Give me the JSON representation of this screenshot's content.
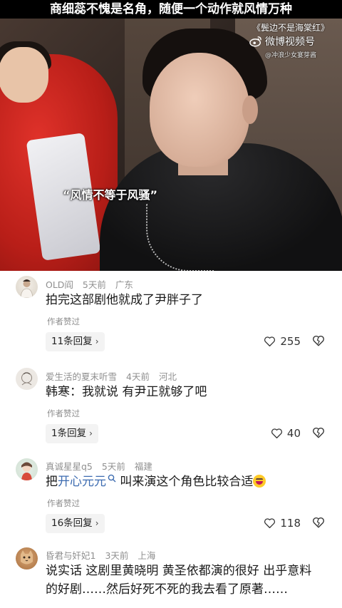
{
  "video": {
    "headline": "商细蕊不愧是名角，随便一个动作就风情万种",
    "watermark_tag": "《鬓边不是海棠红》",
    "watermark_brand": "微博视频号",
    "watermark_user": "@冲浪少女宴芽酱",
    "subtitle": "“风情不等于风骚”"
  },
  "comments": [
    {
      "username": "OLD阎",
      "time": "5天前",
      "location": "广东",
      "text": "拍完这部剧他就成了尹胖子了",
      "badge": "作者赞过",
      "reply_label": "11条回复",
      "likes": "255"
    },
    {
      "username": "爱生活的夏末听雪",
      "time": "4天前",
      "location": "河北",
      "text": "韩寒：我就说 有尹正就够了吧",
      "badge": "作者赞过",
      "reply_label": "1条回复",
      "likes": "40"
    },
    {
      "username": "真诚星星q5",
      "time": "5天前",
      "location": "福建",
      "text_prefix": "把",
      "text_link": "开心元元",
      "text_suffix": " 叫来演这个角色比较合适",
      "badge": "作者赞过",
      "reply_label": "16条回复",
      "likes": "118"
    },
    {
      "username": "昏君与奸妃1",
      "time": "3天前",
      "location": "上海",
      "text": "说实话 这剧里黄晓明 黄圣依都演的很好 出乎意料的好剧……然后好死不死的我去看了原著……"
    }
  ],
  "colors": {
    "link": "#3c6bb0",
    "meta_text": "#8f8f8f",
    "reply_bg": "#f3f3f3",
    "costume_red": "#c8221b"
  },
  "icons": {
    "weibo": "weibo-logo-icon",
    "like": "heart-outline-icon",
    "dislike": "broken-heart-icon",
    "chevron": "chevron-right-icon",
    "search": "search-icon",
    "emoji": "grinning-face-emoji"
  }
}
